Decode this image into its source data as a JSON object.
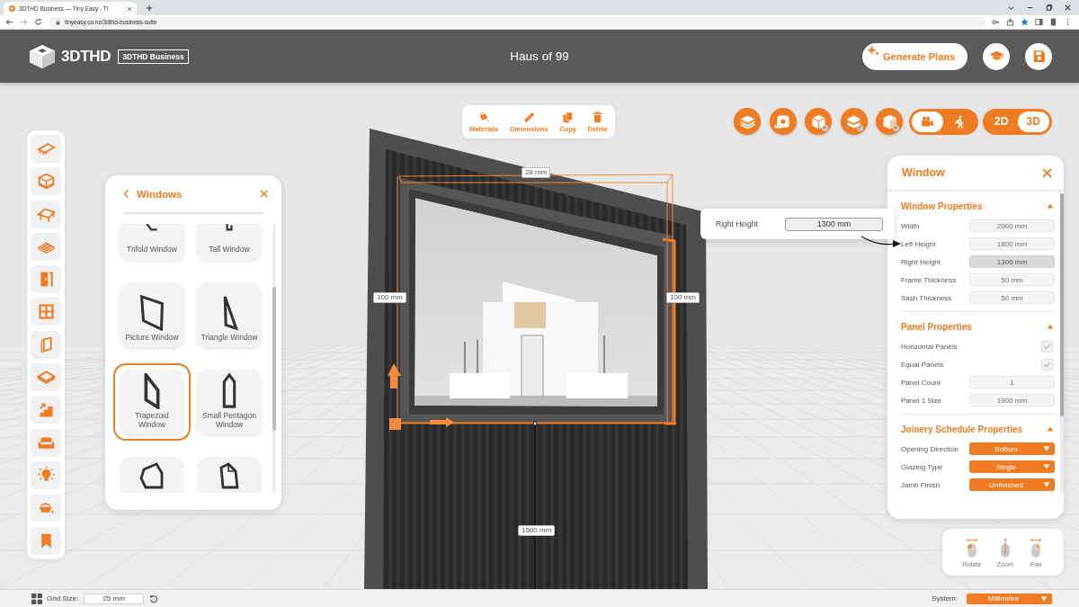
{
  "browser": {
    "tab_title": "3DTHD Business — Tiny Easy - Ti",
    "url": "tinyeasy.co.nz/3dthd-business-suite"
  },
  "header": {
    "logo": "3DTHD",
    "edition": "3DTHD Business",
    "project_title": "Haus of 99",
    "generate_button": "Generate Plans"
  },
  "edit_toolbar": [
    {
      "label": "Materials"
    },
    {
      "label": "Dimensions"
    },
    {
      "label": "Copy"
    },
    {
      "label": "Delete"
    }
  ],
  "camera_toggle": [
    {
      "selected": true
    },
    {
      "selected": false
    }
  ],
  "view_toggle": [
    {
      "label": "2D",
      "selected": false
    },
    {
      "label": "3D",
      "selected": true
    }
  ],
  "windows_panel": {
    "title": "Windows",
    "items": [
      {
        "label": "Trifold Window",
        "selected": false
      },
      {
        "label": "Tall Window",
        "selected": false
      },
      {
        "label": "Picture Window",
        "selected": false
      },
      {
        "label": "Triangle Window",
        "selected": false
      },
      {
        "label": "Trapezoid Window",
        "selected": true
      },
      {
        "label": "Small Pentagon Window",
        "selected": false
      },
      {
        "selected": false
      },
      {
        "selected": false
      }
    ]
  },
  "scene": {
    "dimension_labels": [
      "28 mm",
      "100 mm",
      "100 mm",
      "1500 mm"
    ]
  },
  "callout": {
    "label": "Right Height",
    "value": "1300 mm"
  },
  "properties_panel": {
    "title": "Window",
    "sections": [
      {
        "title": "Window Properties",
        "expanded": true,
        "rows": [
          {
            "kind": "field",
            "label": "Width",
            "value": "2000 mm",
            "highlighted": false
          },
          {
            "kind": "field",
            "label": "Left Height",
            "value": "1800 mm",
            "highlighted": false
          },
          {
            "kind": "field",
            "label": "Right Height",
            "value": "1300 mm",
            "highlighted": true
          },
          {
            "kind": "field",
            "label": "Frame Thickness",
            "value": "50 mm",
            "highlighted": false
          },
          {
            "kind": "field",
            "label": "Sash Thickness",
            "value": "50 mm",
            "highlighted": false
          }
        ]
      },
      {
        "title": "Panel Properties",
        "expanded": true,
        "rows": [
          {
            "kind": "checkbox",
            "label": "Horizontal Panels",
            "checked": true
          },
          {
            "kind": "checkbox",
            "label": "Equal Panels",
            "checked": true
          },
          {
            "kind": "field",
            "label": "Panel Count",
            "value": "1",
            "highlighted": false
          },
          {
            "kind": "field",
            "label": "Panel 1 Size",
            "value": "1900 mm",
            "highlighted": false
          }
        ]
      },
      {
        "title": "Joinery Schedule Properties",
        "expanded": true,
        "rows": [
          {
            "kind": "select",
            "label": "Opening Direction",
            "value": "Bottom"
          },
          {
            "kind": "select",
            "label": "Glazing Type",
            "value": "Single"
          },
          {
            "kind": "select",
            "label": "Jamb Finish",
            "value": "Unfinished"
          }
        ]
      }
    ]
  },
  "view_controls": [
    {
      "label": "Rotate"
    },
    {
      "label": "Zoom"
    },
    {
      "label": "Pan"
    }
  ],
  "status_bar": {
    "grid_label": "Grid Size:",
    "grid_value": "25 mm",
    "system_label": "System:",
    "system_value": "Millimetre"
  }
}
